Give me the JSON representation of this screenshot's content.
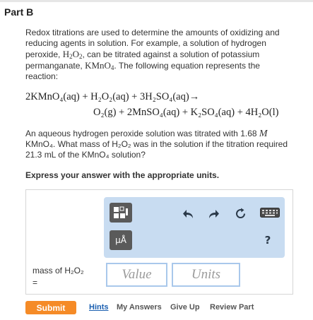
{
  "part": {
    "title": "Part B"
  },
  "problem": {
    "intro_1": "Redox titrations are used to determine the amounts of oxidizing and reducing agents in solution. For example, a solution of hydrogen peroxide, ",
    "h2o2_H": "H",
    "h2o2_sub1": "2",
    "h2o2_O": "O",
    "h2o2_sub2": "2",
    "intro_2": ", can be titrated against a solution of potassium permanganate, ",
    "kmno4_main": "KMnO",
    "kmno4_sub": "4",
    "intro_3": ". The following equation represents the reaction:",
    "equation_line1": "2KMnO₄(aq) + H₂O₂(aq) + 3H₂SO₄(aq)→",
    "equation_line2": "O₂(g) + 2MnSO₄(aq) + K₂SO₄(aq) + 4H₂O(l)",
    "question_1": "An aqueous hydrogen peroxide solution was titrated with 1.68 ",
    "molarity_symbol": "M",
    "question_2": " KMnO₄. What mass of H₂O₂ was in the solution if the titration required 21.3 mL of the KMnO₄ solution?",
    "instruction": "Express your answer with the appropriate units."
  },
  "answer": {
    "label": "mass of H₂O₂",
    "equals": "=",
    "value_placeholder": "Value",
    "units_placeholder": "Units"
  },
  "toolbar": {
    "units_button_label": "μÅ",
    "help_label": "?"
  },
  "actions": {
    "submit": "Submit",
    "hints": "Hints",
    "my_answers": "My Answers",
    "give_up": "Give Up",
    "review_part": "Review Part"
  },
  "colors": {
    "accent_orange": "#f58b27",
    "toolbar_blue": "#c8dcf1",
    "input_border": "#a9c8eb",
    "link_blue": "#1a5fb0"
  },
  "icons": [
    "templates-icon",
    "units-icon",
    "undo-icon",
    "redo-icon",
    "reset-icon",
    "keyboard-icon",
    "help-icon"
  ]
}
